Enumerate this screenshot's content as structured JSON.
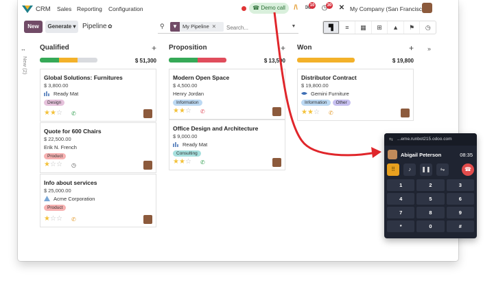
{
  "topbar": {
    "app_name": "CRM",
    "menu": [
      "Sales",
      "Reporting",
      "Configuration"
    ],
    "demo_call_label": "Demo call",
    "messages_badge": "10",
    "activities_badge": "30",
    "company": "My Company (San Francisco)"
  },
  "control": {
    "new_label": "New",
    "generate_label": "Generate ▾",
    "breadcrumb": "Pipeline",
    "filter_tag": "My Pipeline",
    "search_placeholder": "Search..."
  },
  "folded_column": {
    "label": "New (2)"
  },
  "columns": [
    {
      "title": "Qualified",
      "total": "$ 51,300",
      "progress": [
        {
          "color": "#36a957",
          "pct": 33
        },
        {
          "color": "#f3b12a",
          "pct": 33
        },
        {
          "color": "#d9dbdf",
          "pct": 34
        }
      ],
      "cards": [
        {
          "title": "Global Solutions: Furnitures",
          "amount": "$ 3,800.00",
          "company": "Ready Mat",
          "logo": "ready-mat-logo",
          "tags": [
            {
              "label": "Design",
              "color": "#e6c2dc"
            }
          ],
          "stars": 2,
          "activity": "phone-icon",
          "activity_color": "#2f9d4e"
        },
        {
          "title": "Quote for 600 Chairs",
          "amount": "$ 22,500.00",
          "company": "Erik N. French",
          "logo": "",
          "tags": [
            {
              "label": "Product",
              "color": "#f7b2b2"
            }
          ],
          "stars": 1,
          "activity": "clock-icon",
          "activity_color": "#555555"
        },
        {
          "title": "Info about services",
          "amount": "$ 25,000.00",
          "company": "Acme Corporation",
          "logo": "acme-logo",
          "tags": [
            {
              "label": "Product",
              "color": "#f7b2b2"
            }
          ],
          "stars": 1,
          "activity": "phone-icon",
          "activity_color": "#e39a2b"
        }
      ]
    },
    {
      "title": "Proposition",
      "total": "$ 13,500",
      "progress": [
        {
          "color": "#36a957",
          "pct": 50
        },
        {
          "color": "#e04d5c",
          "pct": 50
        }
      ],
      "cards": [
        {
          "title": "Modern Open Space",
          "amount": "$ 4,500.00",
          "company": "Henry Jordan",
          "logo": "",
          "tags": [
            {
              "label": "Information",
              "color": "#bcd9f3"
            }
          ],
          "stars": 2,
          "activity": "phone-icon",
          "activity_color": "#e04d5c"
        },
        {
          "title": "Office Design and Architecture",
          "amount": "$ 9,000.00",
          "company": "Ready Mat",
          "logo": "ready-mat-logo",
          "tags": [
            {
              "label": "Consulting",
              "color": "#a6e0de"
            }
          ],
          "stars": 2,
          "activity": "phone-icon",
          "activity_color": "#2f9d4e"
        }
      ]
    },
    {
      "title": "Won",
      "total": "$ 19,800",
      "progress": [
        {
          "color": "#f3b12a",
          "pct": 100
        }
      ],
      "cards": [
        {
          "title": "Distributor Contract",
          "amount": "$ 19,800.00",
          "company": "Gemini Furniture",
          "logo": "gemini-logo",
          "tags": [
            {
              "label": "Information",
              "color": "#bcd9f3"
            },
            {
              "label": "Other",
              "color": "#c7c0f0"
            }
          ],
          "stars": 2,
          "activity": "phone-icon",
          "activity_color": "#e39a2b"
        }
      ]
    }
  ],
  "phone": {
    "url": "...eme.runbot215.odoo.com",
    "caller": "Abigail Peterson",
    "time": "08:35",
    "keys": [
      "1",
      "2",
      "3",
      "4",
      "5",
      "6",
      "7",
      "8",
      "9",
      "*",
      "0",
      "#"
    ]
  }
}
